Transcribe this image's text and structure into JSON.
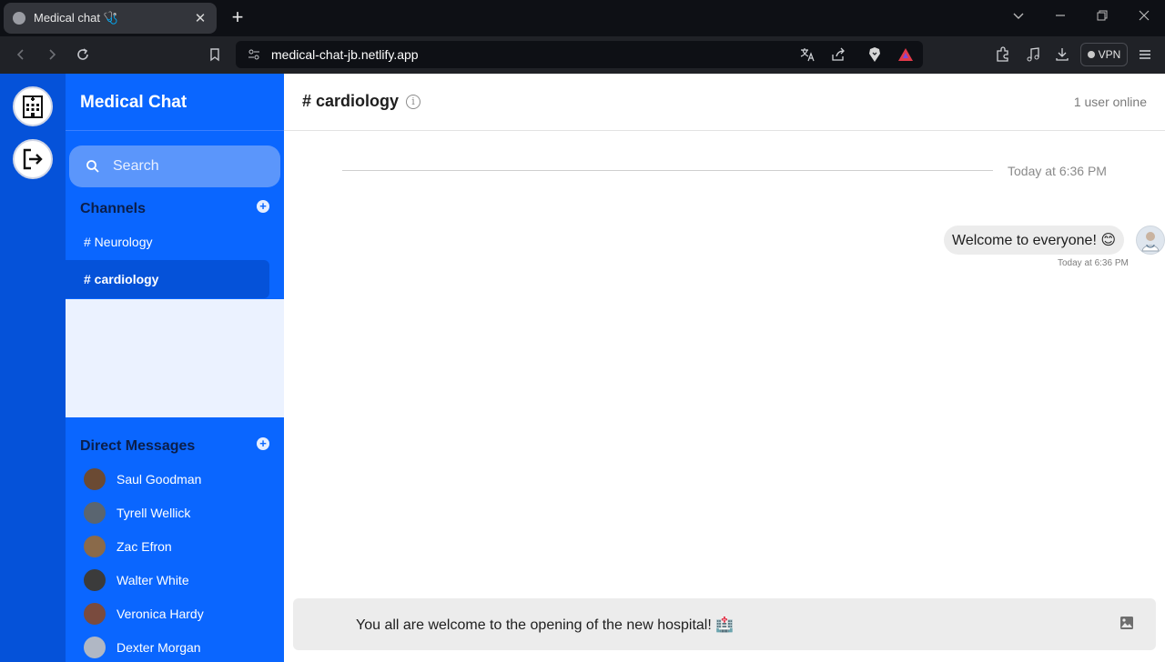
{
  "browser": {
    "tab_title": "Medical chat 🩺",
    "tab_close": "✕",
    "new_tab": "+",
    "url": "medical-chat-jb.netlify.app",
    "vpn_label": "VPN"
  },
  "app": {
    "brand": "Medical Chat",
    "search_placeholder": "Search",
    "channels_title": "Channels",
    "add_symbol": "+",
    "channels": [
      {
        "label": "# Neurology",
        "active": false
      },
      {
        "label": "# cardiology",
        "active": true
      }
    ],
    "dm_title": "Direct Messages",
    "direct_messages": [
      {
        "name": "Saul Goodman",
        "avatar_color": "#6b4a33"
      },
      {
        "name": "Tyrell Wellick",
        "avatar_color": "#5a6570"
      },
      {
        "name": "Zac Efron",
        "avatar_color": "#8a6a4a"
      },
      {
        "name": "Walter White",
        "avatar_color": "#3b3b3b"
      },
      {
        "name": "Veronica Hardy",
        "avatar_color": "#7a4b3e"
      },
      {
        "name": "Dexter Morgan",
        "avatar_color": "#b0b7c4"
      }
    ]
  },
  "chat": {
    "channel_title": "# cardiology",
    "info_symbol": "i",
    "online_status": "1 user online",
    "date_divider": "Today at 6:36 PM",
    "messages": [
      {
        "text": "Welcome to everyone! 😊",
        "time": "Today at 6:36 PM"
      }
    ],
    "composer_text": "You all are welcome to the opening of the new hospital! 🏥"
  },
  "colors": {
    "rail": "#0552d9",
    "sidebar": "#0a66ff",
    "accent": "#0a66ff"
  }
}
